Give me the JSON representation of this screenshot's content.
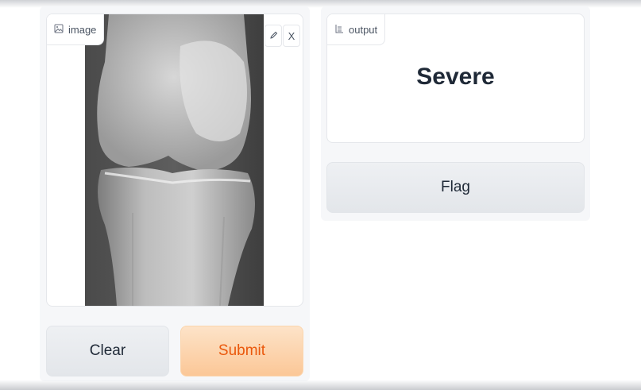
{
  "image_component": {
    "label": "image",
    "label_icon": "image-icon",
    "edit_icon": "pencil-icon",
    "close_label": "X"
  },
  "output_component": {
    "label": "output",
    "label_icon": "label-icon",
    "value": "Severe"
  },
  "buttons": {
    "clear": "Clear",
    "submit": "Submit",
    "flag": "Flag"
  },
  "colors": {
    "submit_bg": "#fbc797",
    "submit_text": "#ea580c",
    "secondary_bg": "#e3e6ea"
  }
}
